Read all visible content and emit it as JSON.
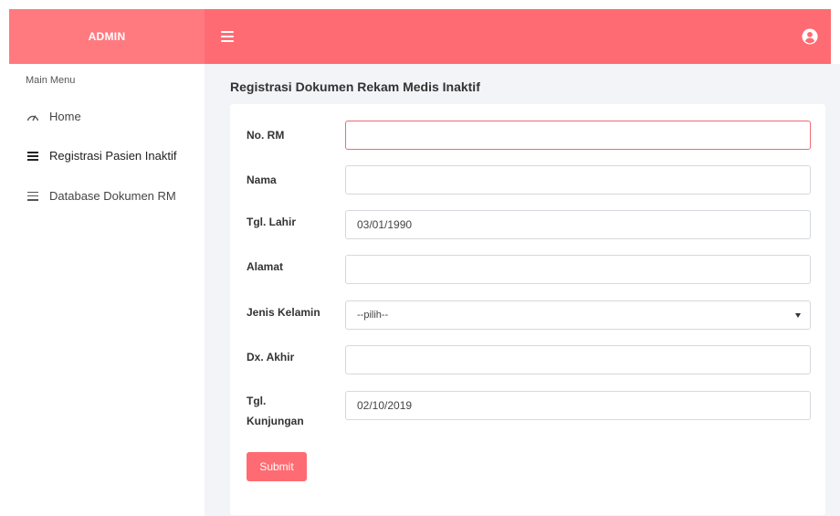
{
  "brand": {
    "label": "ADMIN"
  },
  "sidebar": {
    "header": "Main Menu",
    "items": [
      {
        "label": "Home",
        "icon": "gauge-icon"
      },
      {
        "label": "Registrasi Pasien Inaktif",
        "icon": "list-icon",
        "active": true
      },
      {
        "label": "Database Dokumen RM",
        "icon": "list-icon"
      }
    ]
  },
  "page": {
    "title": "Registrasi Dokumen Rekam Medis Inaktif"
  },
  "form": {
    "no_rm": {
      "label": "No. RM",
      "value": ""
    },
    "nama": {
      "label": "Nama",
      "value": ""
    },
    "tgl_lahir": {
      "label": "Tgl. Lahir",
      "value": "03/01/1990"
    },
    "alamat": {
      "label": "Alamat",
      "value": ""
    },
    "jenis_kelamin": {
      "label": "Jenis Kelamin",
      "selected": "--pilih--"
    },
    "dx_akhir": {
      "label": "Dx. Akhir",
      "value": ""
    },
    "tgl_kunjungan": {
      "label": "Tgl. Kunjungan",
      "value": "02/10/2019"
    },
    "submit_label": "Submit"
  },
  "colors": {
    "accent": "#ff6b72",
    "brand_bg": "#ff7a7f",
    "content_bg": "#f2f4f8"
  }
}
